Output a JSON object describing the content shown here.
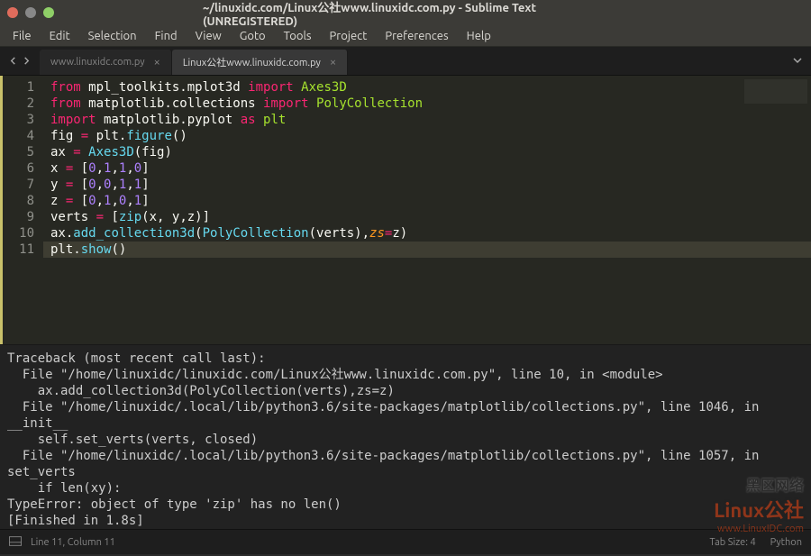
{
  "window": {
    "title": "~/linuxidc.com/Linux公社www.linuxidc.com.py - Sublime Text (UNREGISTERED)"
  },
  "menu": {
    "items": [
      "File",
      "Edit",
      "Selection",
      "Find",
      "View",
      "Goto",
      "Tools",
      "Project",
      "Preferences",
      "Help"
    ]
  },
  "tabs": {
    "items": [
      {
        "label": "www.linuxidc.com.py",
        "active": false
      },
      {
        "label": "Linux公社www.linuxidc.com.py",
        "active": true
      }
    ]
  },
  "code": {
    "lines": [
      {
        "n": 1,
        "html": "<span class='kw'>from</span> mpl_toolkits.mplot3d <span class='kw'>import</span> <span class='nm'>Axes3D</span>"
      },
      {
        "n": 2,
        "html": "<span class='kw'>from</span> matplotlib.collections <span class='kw'>import</span> <span class='nm'>PolyCollection</span>"
      },
      {
        "n": 3,
        "html": "<span class='kw'>import</span> matplotlib.pyplot <span class='kw'>as</span> <span class='nm'>plt</span>"
      },
      {
        "n": 4,
        "html": "fig <span class='kw'>=</span> plt.<span class='fn'>figure</span>()"
      },
      {
        "n": 5,
        "html": "ax <span class='kw'>=</span> <span class='fn'>Axes3D</span>(fig)"
      },
      {
        "n": 6,
        "html": "x <span class='kw'>=</span> [<span class='num'>0</span>,<span class='num'>1</span>,<span class='num'>1</span>,<span class='num'>0</span>]"
      },
      {
        "n": 7,
        "html": "y <span class='kw'>=</span> [<span class='num'>0</span>,<span class='num'>0</span>,<span class='num'>1</span>,<span class='num'>1</span>]"
      },
      {
        "n": 8,
        "html": "z <span class='kw'>=</span> [<span class='num'>0</span>,<span class='num'>1</span>,<span class='num'>0</span>,<span class='num'>1</span>]"
      },
      {
        "n": 9,
        "html": "verts <span class='kw'>=</span> [<span class='fn'>zip</span>(x, y,z)]"
      },
      {
        "n": 10,
        "html": "ax.<span class='fn'>add_collection3d</span>(<span class='fn'>PolyCollection</span>(verts),<span class='par'>zs</span><span class='kw'>=</span>z)"
      },
      {
        "n": 11,
        "html": "plt.<span class='fn'>show</span>()",
        "cursor": true
      }
    ]
  },
  "console": {
    "text": "Traceback (most recent call last):\n  File \"/home/linuxidc/linuxidc.com/Linux公社www.linuxidc.com.py\", line 10, in <module>\n    ax.add_collection3d(PolyCollection(verts),zs=z)\n  File \"/home/linuxidc/.local/lib/python3.6/site-packages/matplotlib/collections.py\", line 1046, in __init__\n    self.set_verts(verts, closed)\n  File \"/home/linuxidc/.local/lib/python3.6/site-packages/matplotlib/collections.py\", line 1057, in set_verts\n    if len(xy):\nTypeError: object of type 'zip' has no len()\n[Finished in 1.8s]"
  },
  "statusbar": {
    "position": "Line 11, Column 11",
    "spaces": "Tab Size: 4",
    "syntax": "Python"
  },
  "watermark": {
    "cn": "黑区网络",
    "logo": "Linux公社",
    "sub": "www.LinuxIDC.com"
  }
}
